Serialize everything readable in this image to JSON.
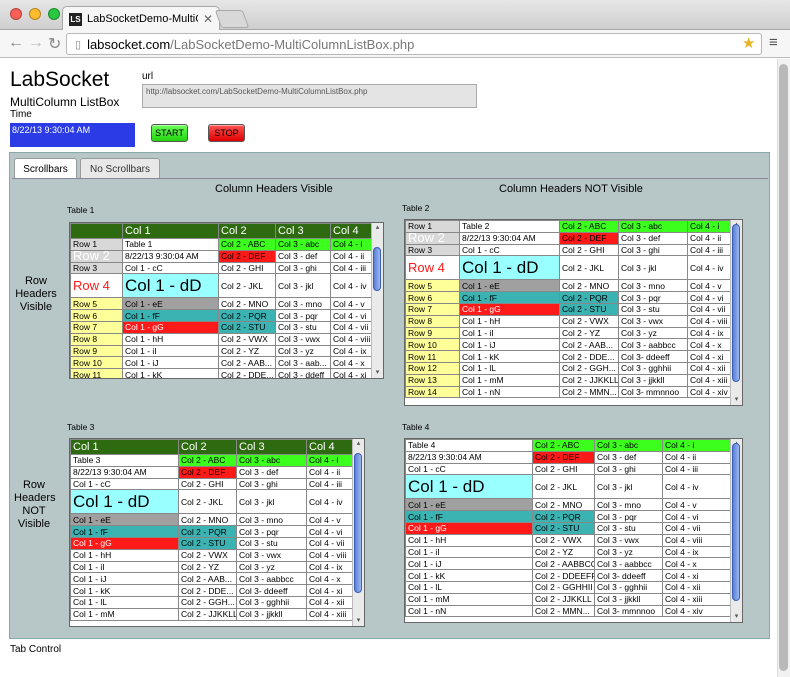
{
  "browser": {
    "tab_title": "LabSocketDemo-MultiColu",
    "tab_favicon": "LS",
    "url_host": "labsocket.com",
    "url_path": "/LabSocketDemo-MultiColumnListBox.php"
  },
  "app": {
    "title": "LabSocket",
    "subtitle": "MultiColumn ListBox",
    "time_label": "Time",
    "time_value": "8/22/13 9:30:04 AM",
    "url_label": "url",
    "url_value": "http://labsocket.com/LabSocketDemo-MultiColumnListBox.php",
    "start_label": "START",
    "stop_label": "STOP",
    "tab_control_label": "Tab Control"
  },
  "tabs": [
    "Scrollbars",
    "No Scrollbars"
  ],
  "headers": {
    "col_visible": "Column Headers Visible",
    "col_not_visible": "Column Headers NOT Visible",
    "row_visible": "Row\nHeaders\nVisible",
    "row_not_visible": "Row\nHeaders\nNOT\nVisible"
  },
  "colors": {
    "green_dark": "#2e6b10",
    "green": "#3cff1e",
    "red": "#ff1a1a",
    "yellow": "#ffff99",
    "teal": "#3cb3b3",
    "gray": "#a0a0a0",
    "cyan": "#99ffff"
  },
  "tables": [
    {
      "name": "Table 1",
      "col_headers": [
        "Col 1",
        "Col 2",
        "Col 3",
        "Col 4"
      ],
      "row_headers": [
        "Row 1",
        "Row 2",
        "Row 3",
        "Row 4",
        "Row 5",
        "Row 6",
        "Row 7",
        "Row 8",
        "Row 9",
        "Row 10",
        "Row 11"
      ],
      "rows": [
        [
          "Table 1",
          "Col 2 - ABC",
          "Col 3 - abc",
          "Col 4 - i"
        ],
        [
          "8/22/13 9:30:04 AM",
          "Col 2 - DEF",
          "Col 3 - def",
          "Col 4 - ii"
        ],
        [
          "Col 1 - cC",
          "Col 2 - GHI",
          "Col 3 - ghi",
          "Col 4 - iii"
        ],
        [
          "Col 1 - dD",
          "Col 2 - JKL",
          "Col 3 - jkl",
          "Col 4 - iv"
        ],
        [
          "Col 1 - eE",
          "Col 2 - MNO",
          "Col 3 - mno",
          "Col 4 - v"
        ],
        [
          "Col 1 - fF",
          "Col 2 - PQR",
          "Col 3 - pqr",
          "Col 4 - vi"
        ],
        [
          "Col 1 - gG",
          "Col 2 - STU",
          "Col 3 - stu",
          "Col 4 - vii"
        ],
        [
          "Col 1 - hH",
          "Col 2 - VWX",
          "Col 3 - vwx",
          "Col 4 - viii"
        ],
        [
          "Col 1 - iI",
          "Col 2 - YZ",
          "Col 3 - yz",
          "Col 4 - ix"
        ],
        [
          "Col 1 - iJ",
          "Col 2 - AAB...",
          "Col 3 - aab...",
          "Col 4 - x"
        ],
        [
          "Col 1 - kK",
          "Col 2 - DDE...",
          "Col 3 - ddeff",
          "Col 4 - xi"
        ]
      ]
    },
    {
      "name": "Table 2",
      "row_headers": [
        "Row 1",
        "Row 2",
        "Row 3",
        "Row 4",
        "Row 5",
        "Row 6",
        "Row 7",
        "Row 8",
        "Row 9",
        "Row 10",
        "Row 11",
        "Row 12",
        "Row 13",
        "Row 14"
      ],
      "rows": [
        [
          "Table 2",
          "Col 2 - ABC",
          "Col 3 - abc",
          "Col 4 - i"
        ],
        [
          "8/22/13 9:30:04 AM",
          "Col 2 - DEF",
          "Col 3 - def",
          "Col 4 - ii"
        ],
        [
          "Col 1 - cC",
          "Col 2 - GHI",
          "Col 3 - ghi",
          "Col 4 - iii"
        ],
        [
          "Col 1 - dD",
          "Col 2 - JKL",
          "Col 3 - jkl",
          "Col 4 - iv"
        ],
        [
          "Col 1 - eE",
          "Col 2 - MNO",
          "Col 3 - mno",
          "Col 4 - v"
        ],
        [
          "Col 1 - fF",
          "Col 2 - PQR",
          "Col 3 - pqr",
          "Col 4 - vi"
        ],
        [
          "Col 1 - gG",
          "Col 2 - STU",
          "Col 3 - stu",
          "Col 4 - vii"
        ],
        [
          "Col 1 - hH",
          "Col 2 - VWX",
          "Col 3 - vwx",
          "Col 4 - viii"
        ],
        [
          "Col 1 - iI",
          "Col 2 - YZ",
          "Col 3 - yz",
          "Col 4 - ix"
        ],
        [
          "Col 1 - iJ",
          "Col 2 - AAB...",
          "Col 3 - aabbcc",
          "Col 4 - x"
        ],
        [
          "Col 1 - kK",
          "Col 2 - DDE...",
          "Col 3- ddeeff",
          "Col 4 - xi"
        ],
        [
          "Col 1 - lL",
          "Col 2 - GGH...",
          "Col 3 - gghhii",
          "Col 4 - xii"
        ],
        [
          "Col 1 - mM",
          "Col 2 - JJKKLL",
          "Col 3 - jjkkll",
          "Col 4 - xiii"
        ],
        [
          "Col 1 - nN",
          "Col 2 - MMN...",
          "Col 3- mmnnoo",
          "Col 4 - xiv"
        ]
      ]
    },
    {
      "name": "Table 3",
      "col_headers": [
        "Col 1",
        "Col 2",
        "Col 3",
        "Col 4"
      ],
      "rows": [
        [
          "Table 3",
          "Col 2 - ABC",
          "Col 3 - abc",
          "Col 4 - i"
        ],
        [
          "8/22/13 9:30:04 AM",
          "Col 2 - DEF",
          "Col 3 - def",
          "Col 4 - ii"
        ],
        [
          "Col 1 - cC",
          "Col 2 - GHI",
          "Col 3 - ghi",
          "Col 4 - iii"
        ],
        [
          "Col 1 - dD",
          "Col 2 - JKL",
          "Col 3 - jkl",
          "Col 4 - iv"
        ],
        [
          "Col 1 - eE",
          "Col 2 - MNO",
          "Col 3 - mno",
          "Col 4 - v"
        ],
        [
          "Col 1 - fF",
          "Col 2 - PQR",
          "Col 3 - pqr",
          "Col 4 - vi"
        ],
        [
          "Col 1 - gG",
          "Col 2 - STU",
          "Col 3 - stu",
          "Col 4 - vii"
        ],
        [
          "Col 1 - hH",
          "Col 2 - VWX",
          "Col 3 - vwx",
          "Col 4 - viii"
        ],
        [
          "Col 1 - iI",
          "Col 2 - YZ",
          "Col 3 - yz",
          "Col 4 - ix"
        ],
        [
          "Col 1 - iJ",
          "Col 2 - AAB...",
          "Col 3 - aabbcc",
          "Col 4 - x"
        ],
        [
          "Col 1 - kK",
          "Col 2 - DDE...",
          "Col 3- ddeeff",
          "Col 4 - xi"
        ],
        [
          "Col 1 - lL",
          "Col 2 - GGH...",
          "Col 3 - gghhii",
          "Col 4 - xii"
        ],
        [
          "Col 1 - mM",
          "Col 2 - JJKKLL",
          "Col 3 - jjkkll",
          "Col 4 - xiii"
        ]
      ]
    },
    {
      "name": "Table 4",
      "rows": [
        [
          "Table 4",
          "Col 2 - ABC",
          "Col 3 - abc",
          "Col 4 - i"
        ],
        [
          "8/22/13 9:30:04 AM",
          "Col 2 - DEF",
          "Col 3 - def",
          "Col 4 - ii"
        ],
        [
          "Col 1 - cC",
          "Col 2 - GHI",
          "Col 3 - ghi",
          "Col 4 - iii"
        ],
        [
          "Col 1 - dD",
          "Col 2 - JKL",
          "Col 3 - jkl",
          "Col 4 - iv"
        ],
        [
          "Col 1 - eE",
          "Col 2 - MNO",
          "Col 3 - mno",
          "Col 4 - v"
        ],
        [
          "Col 1 - fF",
          "Col 2 - PQR",
          "Col 3 - pqr",
          "Col 4 - vi"
        ],
        [
          "Col 1 - gG",
          "Col 2 - STU",
          "Col 3 - stu",
          "Col 4 - vii"
        ],
        [
          "Col 1 - hH",
          "Col 2 - VWX",
          "Col 3 - vwx",
          "Col 4 - viii"
        ],
        [
          "Col 1 - iI",
          "Col 2 - YZ",
          "Col 3 - yz",
          "Col 4 - ix"
        ],
        [
          "Col 1 - iJ",
          "Col 2 - AABBCC",
          "Col 3 - aabbcc",
          "Col 4 - x"
        ],
        [
          "Col 1 - kK",
          "Col 2 - DDEEFF",
          "Col 3- ddeeff",
          "Col 4 - xi"
        ],
        [
          "Col 1 - lL",
          "Col 2 - GGHHII",
          "Col 3 - gghhii",
          "Col 4 - xii"
        ],
        [
          "Col 1 - mM",
          "Col 2 - JJKKLL",
          "Col 3 - jjkkll",
          "Col 4 - xiii"
        ],
        [
          "Col 1 - nN",
          "Col 2 - MMN...",
          "Col 3- mmnnoo",
          "Col 4 - xiv"
        ]
      ]
    }
  ]
}
